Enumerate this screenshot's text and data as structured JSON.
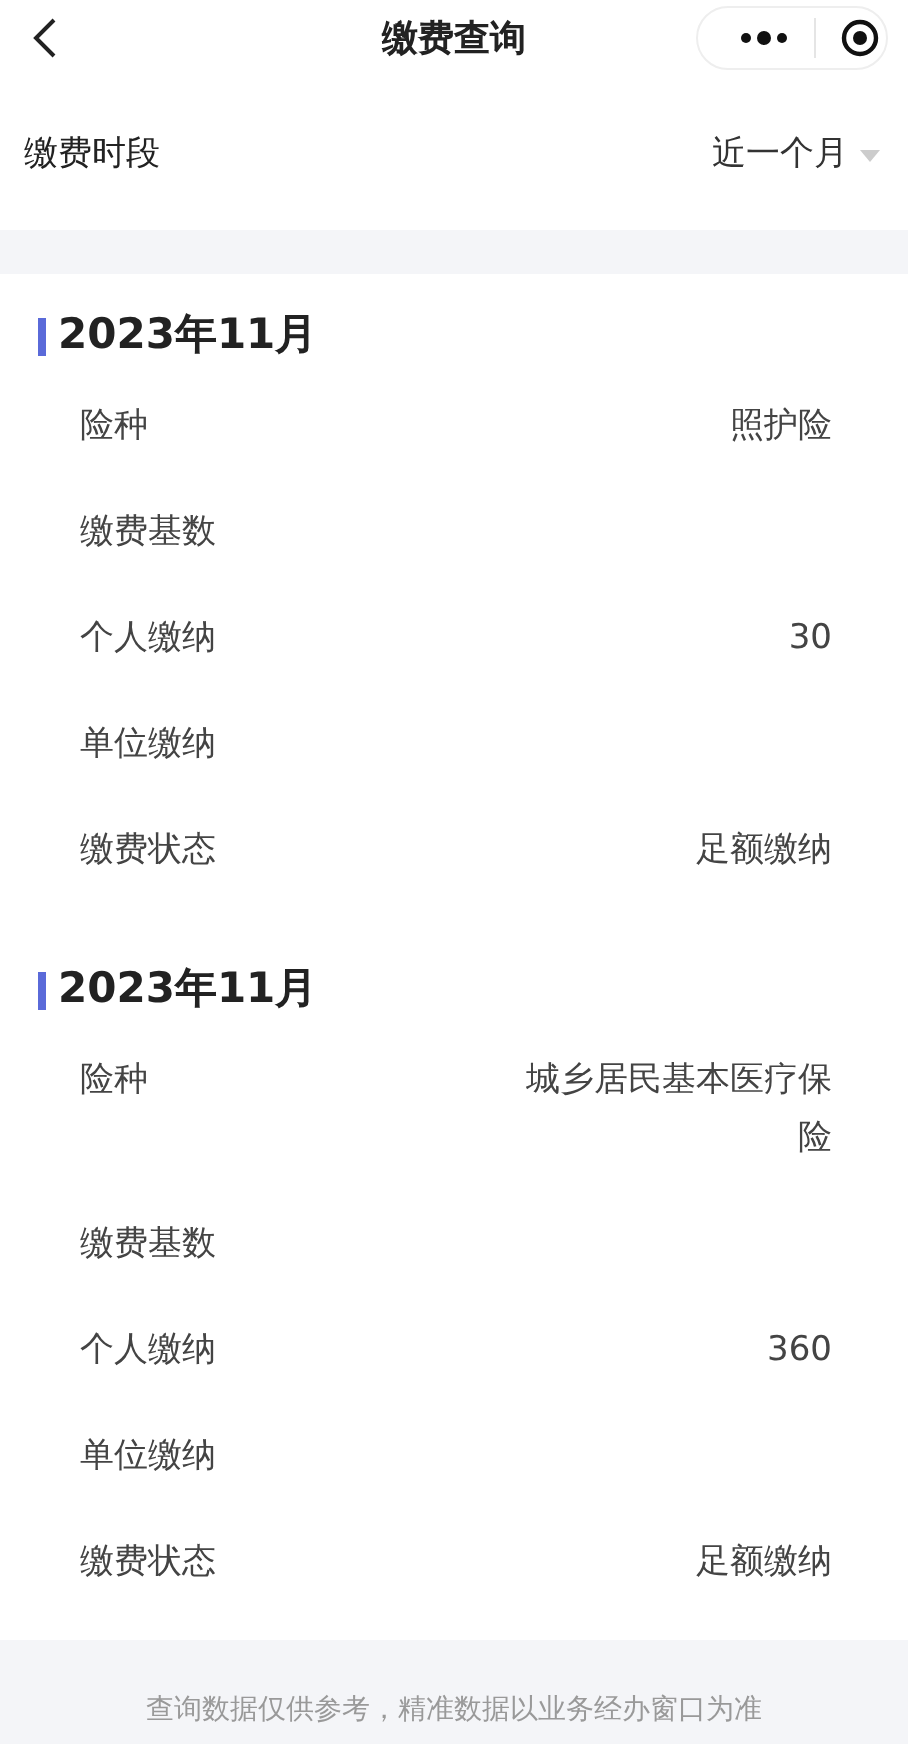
{
  "header": {
    "title": "缴费查询"
  },
  "filter": {
    "label": "缴费时段",
    "value": "近一个月"
  },
  "records": [
    {
      "period": "2023年11月",
      "fields": [
        {
          "label": "险种",
          "value": "照护险"
        },
        {
          "label": "缴费基数"
        },
        {
          "label": "个人缴纳",
          "value": "30"
        },
        {
          "label": "单位缴纳"
        },
        {
          "label": "缴费状态",
          "value": "足额缴纳"
        }
      ]
    },
    {
      "period": "2023年11月",
      "fields": [
        {
          "label": "险种",
          "value": "城乡居民基本医疗保险"
        },
        {
          "label": "缴费基数"
        },
        {
          "label": "个人缴纳",
          "value": "360"
        },
        {
          "label": "单位缴纳"
        },
        {
          "label": "缴费状态",
          "value": "足额缴纳"
        }
      ]
    }
  ],
  "footer": "查询数据仅供参考，精准数据以业务经办窗口为准"
}
